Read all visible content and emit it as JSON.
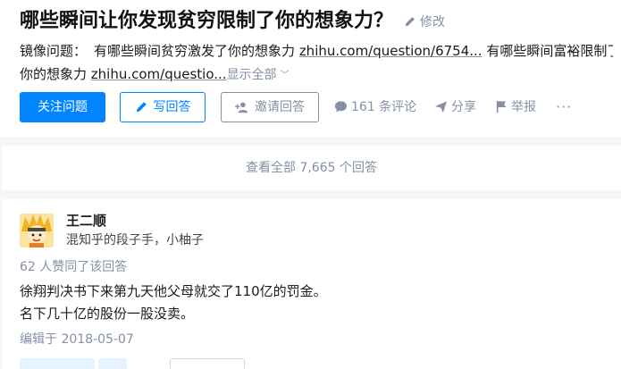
{
  "question": {
    "title": "哪些瞬间让你发现贫穷限制了你的想象力？",
    "edit_label": "修改",
    "detail_prefix": "镜像问题：",
    "detail_text_1": "有哪些瞬间贫穷激发了你的想象力",
    "detail_link_1": "zhihu.com/question/6754...",
    "detail_text_2": "有哪些瞬间富裕限制了",
    "detail_text_3": "你的想象力",
    "detail_link_2": "zhihu.com/questio...",
    "show_all_label": "显示全部"
  },
  "actions": {
    "follow_label": "关注问题",
    "write_label": "写回答",
    "invite_label": "邀请回答",
    "comment_label": "161 条评论",
    "share_label": "分享",
    "report_label": "举报",
    "more_label": "···"
  },
  "view_all_label": "查看全部 7,665 个回答",
  "answer": {
    "author_name": "王二顺",
    "author_bio": "混知乎的段子手，小柚子",
    "votes_note": "62 人赞同了该回答",
    "content": [
      "徐翔判决书下来第九天他父母就交了110亿的罚金。",
      "名下几十亿的股份一股没卖。"
    ],
    "edited_label": "编辑于 2018-05-07"
  },
  "colors": {
    "brand_blue": "#0084ff",
    "muted_gray": "#8590a6",
    "page_bg": "#f6f6f6"
  },
  "icons": [
    "pencil-icon",
    "person-plus-icon",
    "comment-bubble-icon",
    "paper-plane-icon",
    "flag-icon",
    "more-icon",
    "chevron-down-icon"
  ]
}
